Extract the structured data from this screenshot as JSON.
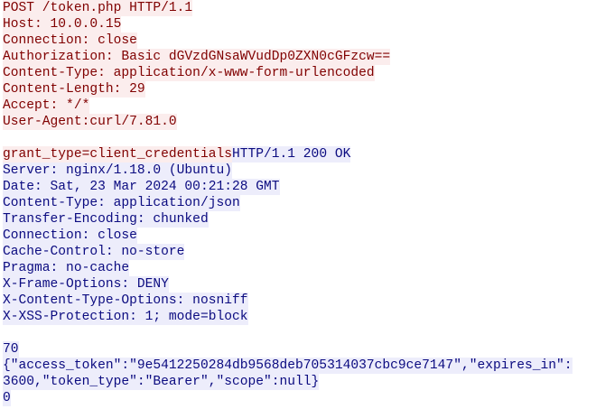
{
  "request": {
    "lines": [
      "POST /token.php HTTP/1.1",
      "Host: 10.0.0.15",
      "Connection: close",
      "Authorization: Basic dGVzdGNsaWVudDp0ZXN0cGFzcw==",
      "Content-Type: application/x-www-form-urlencoded",
      "Content-Length: 29",
      "Accept: */*",
      "User-Agent:curl/7.81.0"
    ],
    "body": "grant_type=client_credentials"
  },
  "response": {
    "status_line": "HTTP/1.1 200 OK",
    "headers": [
      "Server: nginx/1.18.0 (Ubuntu)",
      "Date: Sat, 23 Mar 2024 00:21:28 GMT",
      "Content-Type: application/json",
      "Transfer-Encoding: chunked",
      "Connection: close",
      "Cache-Control: no-store",
      "Pragma: no-cache",
      "X-Frame-Options: DENY",
      "X-Content-Type-Options: nosniff",
      "X-XSS-Protection: 1; mode=block"
    ],
    "chunk_size": "70",
    "body_lines": [
      "{\"access_token\":\"9e5412250284db9568deb705314037cbc9ce7147\",\"expires_in\":",
      "3600,\"token_type\":\"Bearer\",\"scope\":null}"
    ],
    "terminal_chunk": "0"
  },
  "colors": {
    "client_text": "#800000",
    "client_background": "#fbeded",
    "server_text": "#0b0b80",
    "server_background": "#ededfb"
  }
}
